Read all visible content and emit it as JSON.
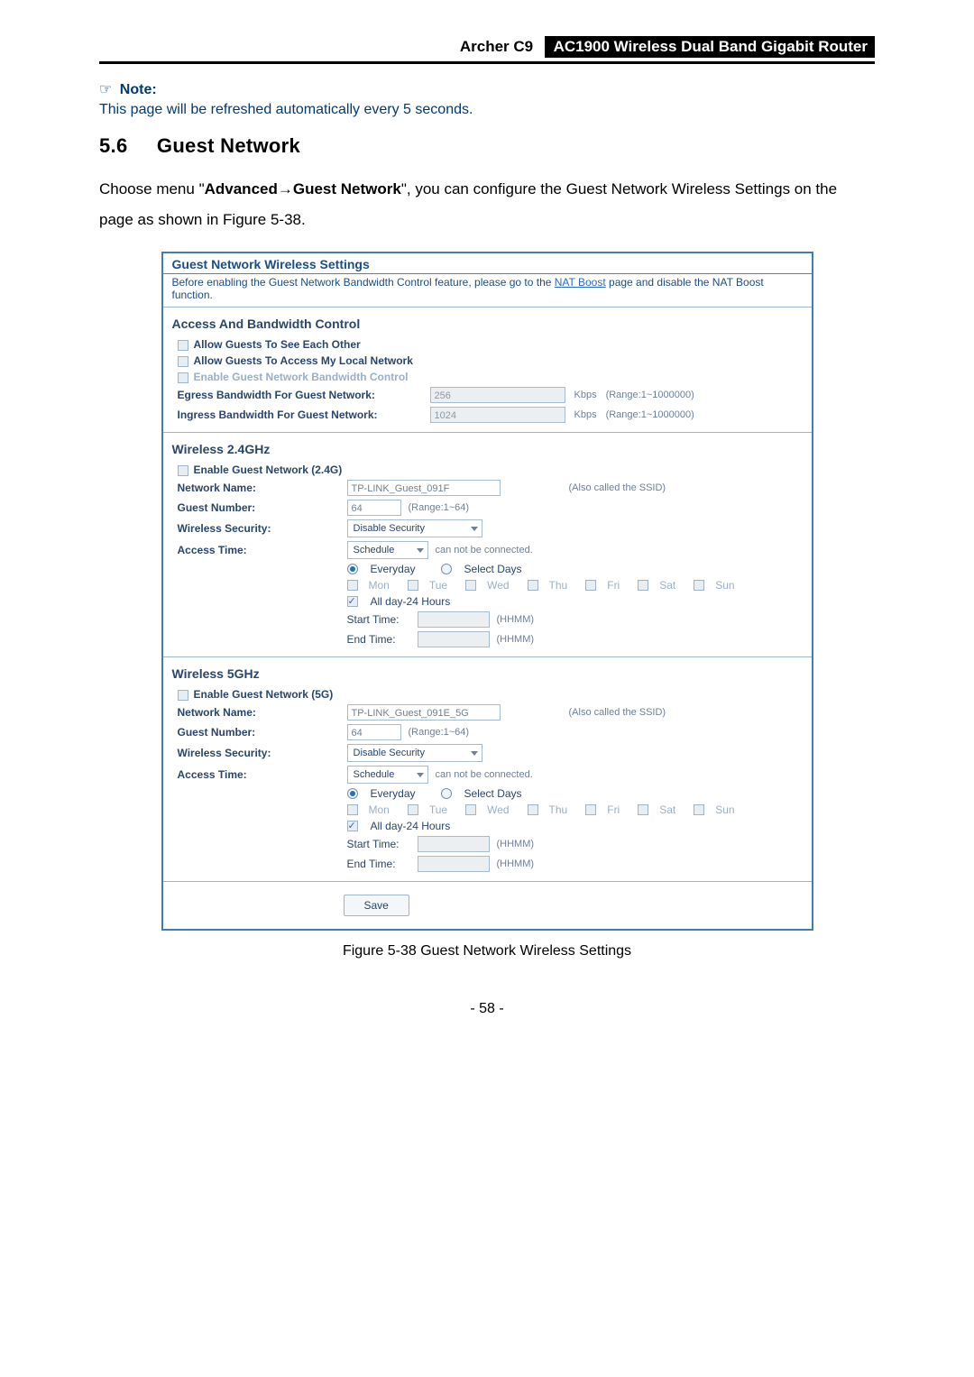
{
  "header": {
    "model": "Archer C9",
    "product": "AC1900 Wireless Dual Band Gigabit Router"
  },
  "note": {
    "label": "Note:",
    "msg": "This page will be refreshed automatically every 5 seconds."
  },
  "section": {
    "number": "5.6",
    "title": "Guest Network"
  },
  "intro": {
    "t1": "Choose menu \"",
    "nav1": "Advanced",
    "arrow": "→",
    "nav2": "Guest Network",
    "t2": "\", you can configure the Guest Network Wireless Settings on the page as shown in Figure 5-38."
  },
  "panel": {
    "title": "Guest Network Wireless Settings",
    "warning_pre": "Before enabling the Guest Network Bandwidth Control feature, please go to the ",
    "warning_link": "NAT Boost",
    "warning_post": " page and disable the NAT Boost function.",
    "bandwidth": {
      "heading": "Access And Bandwidth Control",
      "seeEach": "Allow Guests To See Each Other",
      "accessLocal": "Allow Guests To Access My Local Network",
      "enableBw": "Enable Guest Network Bandwidth Control",
      "egressLabel": "Egress Bandwidth For Guest Network:",
      "ingressLabel": "Ingress Bandwidth For Guest Network:",
      "egressValue": "256",
      "ingressValue": "1024",
      "unit": "Kbps",
      "range": "(Range:1~1000000)"
    },
    "w24": {
      "heading": "Wireless 2.4GHz",
      "enable": "Enable Guest Network (2.4G)",
      "nameLabel": "Network Name:",
      "nameValue": "TP-LINK_Guest_091F",
      "ssidNote": "(Also called the SSID)",
      "guestLabel": "Guest Number:",
      "guestValue": "64",
      "guestRange": "(Range:1~64)",
      "secLabel": "Wireless Security:",
      "secValue": "Disable Security",
      "accessLabel": "Access Time:",
      "accessValue": "Schedule",
      "accessNote": "can not be connected.",
      "everyday": "Everyday",
      "selectDays": "Select Days",
      "days": [
        "Mon",
        "Tue",
        "Wed",
        "Thu",
        "Fri",
        "Sat",
        "Sun"
      ],
      "allDay": "All day-24 Hours",
      "startTime": "Start Time:",
      "endTime": "End Time:",
      "hhmm": "(HHMM)"
    },
    "w5": {
      "heading": "Wireless 5GHz",
      "enable": "Enable Guest Network (5G)",
      "nameLabel": "Network Name:",
      "nameValue": "TP-LINK_Guest_091E_5G",
      "ssidNote": "(Also called the SSID)",
      "guestLabel": "Guest Number:",
      "guestValue": "64",
      "guestRange": "(Range:1~64)",
      "secLabel": "Wireless Security:",
      "secValue": "Disable Security",
      "accessLabel": "Access Time:",
      "accessValue": "Schedule",
      "accessNote": "can not be connected.",
      "everyday": "Everyday",
      "selectDays": "Select Days",
      "days": [
        "Mon",
        "Tue",
        "Wed",
        "Thu",
        "Fri",
        "Sat",
        "Sun"
      ],
      "allDay": "All day-24 Hours",
      "startTime": "Start Time:",
      "endTime": "End Time:",
      "hhmm": "(HHMM)"
    },
    "save": "Save"
  },
  "figure": "Figure 5-38 Guest Network Wireless Settings",
  "pageNum": "- 58 -"
}
